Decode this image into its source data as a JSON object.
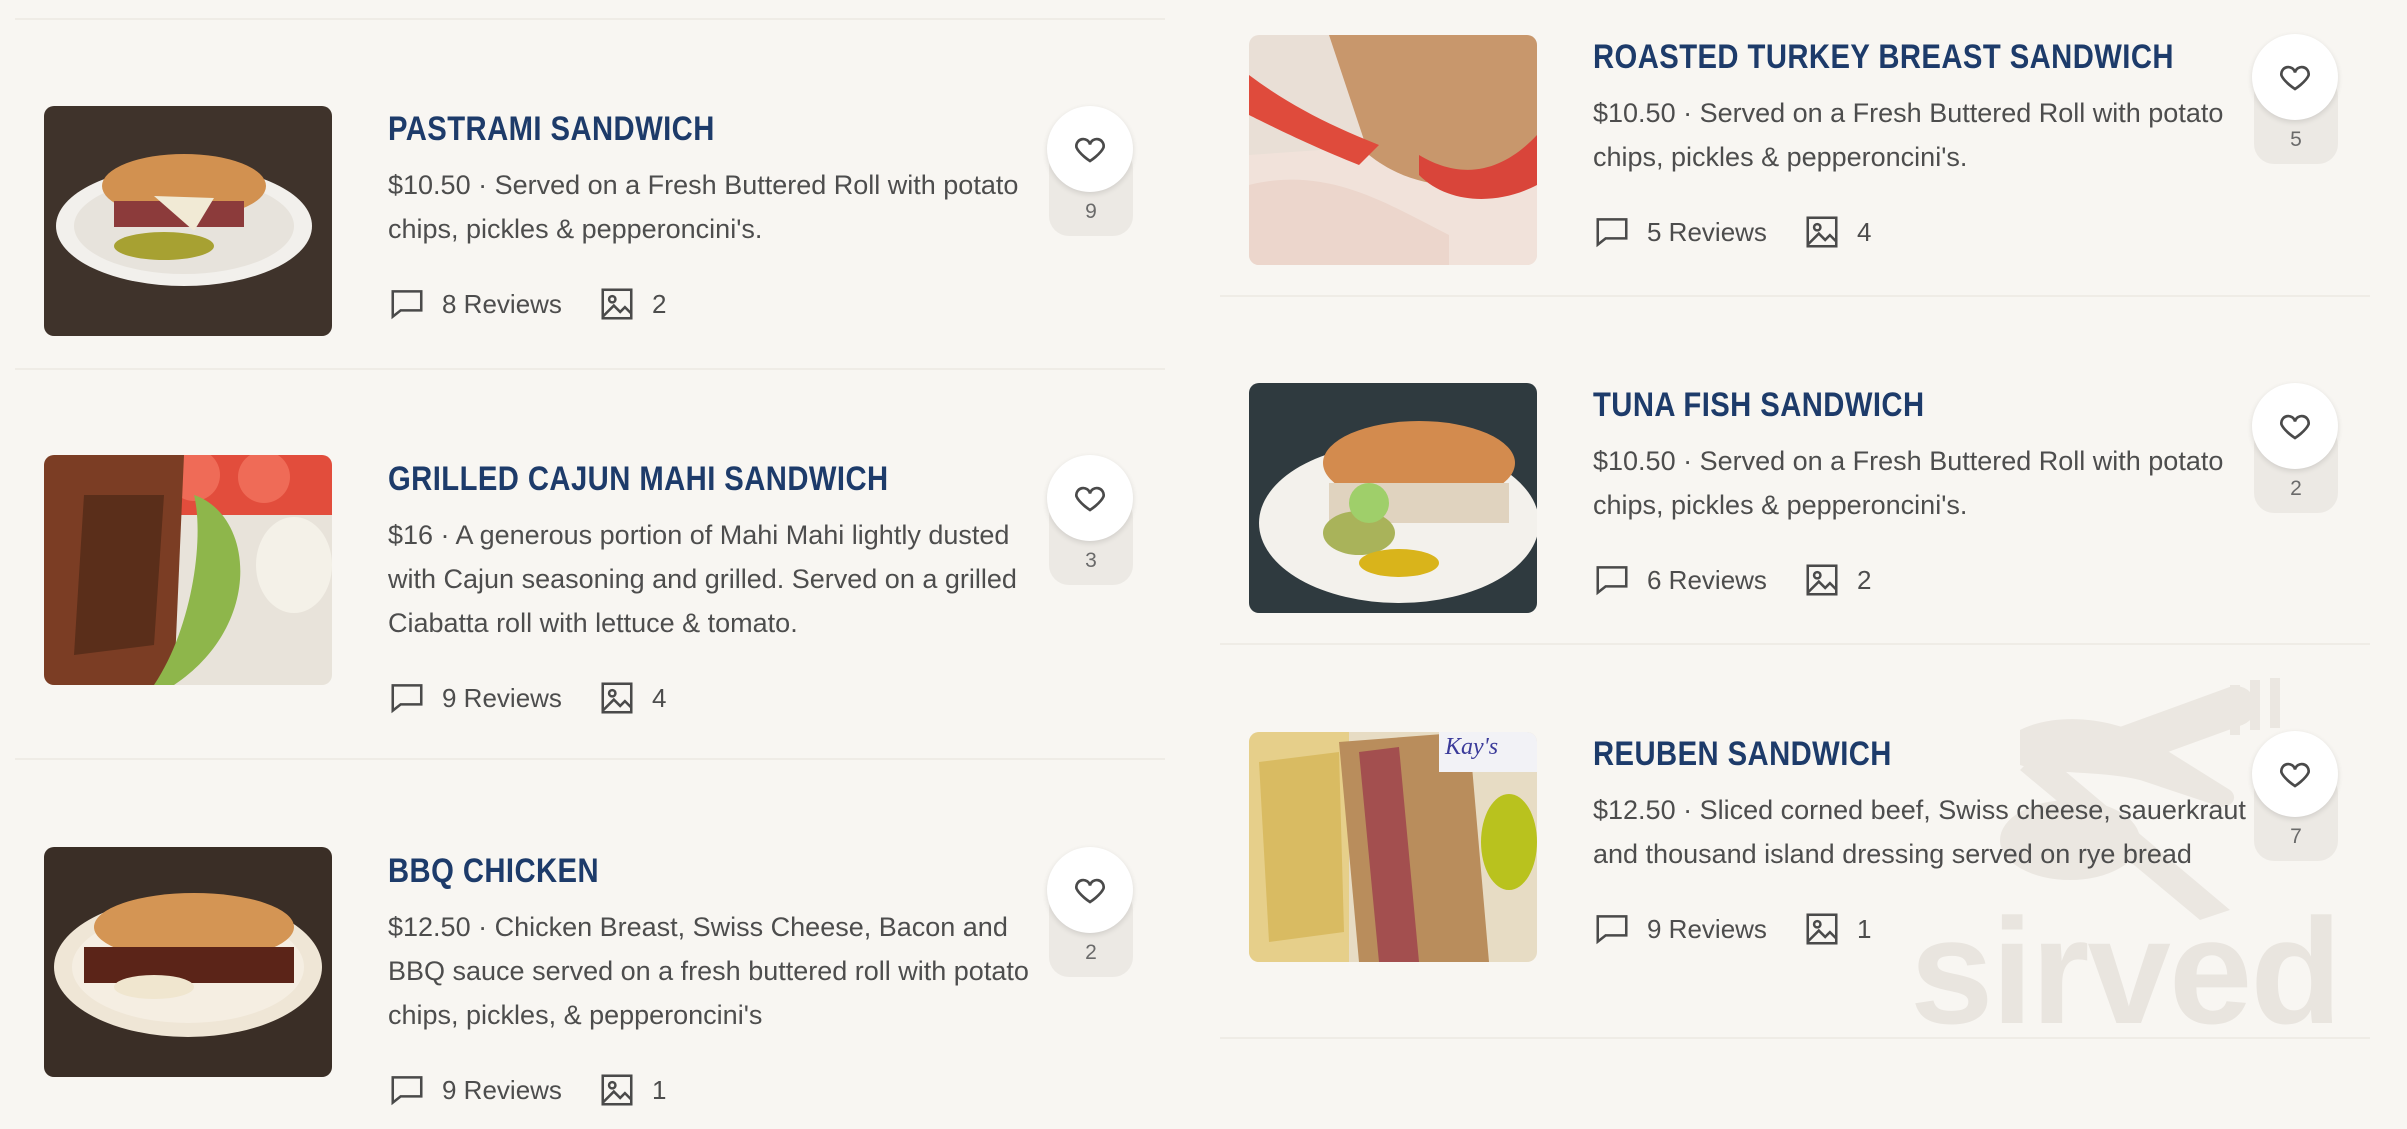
{
  "items": [
    {
      "title": "PASTRAMI SANDWICH",
      "description": "$10.50 · Served on a Fresh Buttered Roll with potato chips, pickles & pepperoncini's.",
      "reviews": "8 Reviews",
      "photos": "2",
      "likes": "9"
    },
    {
      "title": "GRILLED CAJUN MAHI SANDWICH",
      "description": "$16 · A generous portion of Mahi Mahi lightly dusted with Cajun seasoning and grilled. Served on a grilled Ciabatta roll with lettuce & tomato.",
      "reviews": "9 Reviews",
      "photos": "4",
      "likes": "3"
    },
    {
      "title": "BBQ CHICKEN",
      "description": "$12.50 · Chicken Breast, Swiss Cheese, Bacon and BBQ sauce served on a fresh buttered roll with potato chips, pickles, & pepperoncini's",
      "reviews": "9 Reviews",
      "photos": "1",
      "likes": "2"
    },
    {
      "title": "ROASTED TURKEY BREAST SANDWICH",
      "description": "$10.50 · Served on a Fresh Buttered Roll with potato chips, pickles & pepperoncini's.",
      "reviews": "5 Reviews",
      "photos": "4",
      "likes": "5"
    },
    {
      "title": "TUNA FISH SANDWICH",
      "description": "$10.50 · Served on a Fresh Buttered Roll with potato chips, pickles & pepperoncini's.",
      "reviews": "6 Reviews",
      "photos": "2",
      "likes": "2"
    },
    {
      "title": "REUBEN SANDWICH",
      "description": "$12.50 · Sliced corned beef, Swiss cheese, sauerkraut and thousand island dressing served on rye bread",
      "reviews": "9 Reviews",
      "photos": "1",
      "likes": "7"
    }
  ],
  "watermark": {
    "text": "sirved",
    "photo_caption": "Kay's"
  },
  "colors": {
    "title": "#1d3b6a",
    "background": "#f8f6f2",
    "divider": "#efece6"
  },
  "icons": {
    "reviews": "comment-icon",
    "photos": "image-icon",
    "like": "heart-icon"
  }
}
